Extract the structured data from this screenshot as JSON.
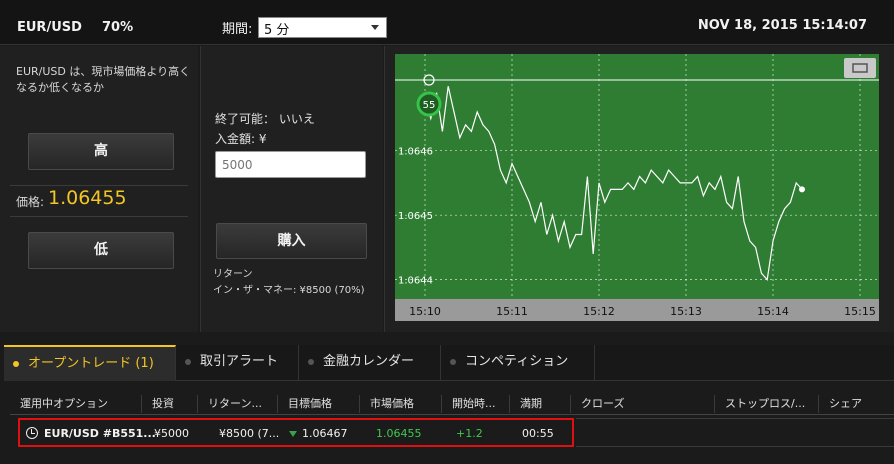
{
  "header": {
    "pair": "EUR/USD",
    "payout_pct": "70%",
    "period_label": "期間:",
    "period_value": "5 分",
    "datetime": "NOV 18, 2015 15:14:07"
  },
  "left": {
    "description": "EUR/USD は、現市場価格より高くなるか低くなるか",
    "high_label": "高",
    "price_label": "価格:",
    "price_value": "1.06455",
    "low_label": "低"
  },
  "mid": {
    "expiry_text": "終了可能： いいえ",
    "deposit_label": "入金額: ¥",
    "amount_placeholder": "5000",
    "buy_label": "購入",
    "return_label": "リターン",
    "in_the_money": "イン・ザ・マネー: ¥8500 (70%)"
  },
  "chart_data": {
    "type": "line",
    "x_ticks": [
      "15:10",
      "15:11",
      "15:12",
      "15:13",
      "15:14",
      "15:15"
    ],
    "y_ticks": [
      "1.0646",
      "1.0645",
      "1.0644"
    ],
    "ylim": [
      1.06437,
      1.06475
    ],
    "grid": true,
    "background": "#2e7d32",
    "line_color": "#ffffff",
    "marker_label": "55",
    "series": [
      {
        "points": [
          [
            "15:10:00",
            1.06468
          ],
          [
            "15:10:04",
            1.06465
          ],
          [
            "15:10:08",
            1.06469
          ],
          [
            "15:10:12",
            1.06463
          ],
          [
            "15:10:16",
            1.0647
          ],
          [
            "15:10:20",
            1.06466
          ],
          [
            "15:10:24",
            1.06462
          ],
          [
            "15:10:28",
            1.06464
          ],
          [
            "15:10:32",
            1.06463
          ],
          [
            "15:10:36",
            1.06466
          ],
          [
            "15:10:40",
            1.06464
          ],
          [
            "15:10:44",
            1.06463
          ],
          [
            "15:10:48",
            1.06461
          ],
          [
            "15:10:52",
            1.06457
          ],
          [
            "15:10:56",
            1.06455
          ],
          [
            "15:11:00",
            1.06458
          ],
          [
            "15:11:04",
            1.06456
          ],
          [
            "15:11:08",
            1.06454
          ],
          [
            "15:11:12",
            1.06452
          ],
          [
            "15:11:16",
            1.06449
          ],
          [
            "15:11:20",
            1.06452
          ],
          [
            "15:11:24",
            1.06447
          ],
          [
            "15:11:28",
            1.0645
          ],
          [
            "15:11:32",
            1.06446
          ],
          [
            "15:11:36",
            1.06449
          ],
          [
            "15:11:40",
            1.06445
          ],
          [
            "15:11:44",
            1.06447
          ],
          [
            "15:11:48",
            1.06447
          ],
          [
            "15:11:52",
            1.06456
          ],
          [
            "15:11:56",
            1.06444
          ],
          [
            "15:12:00",
            1.06455
          ],
          [
            "15:12:04",
            1.06452
          ],
          [
            "15:12:08",
            1.06454
          ],
          [
            "15:12:12",
            1.06454
          ],
          [
            "15:12:16",
            1.06454
          ],
          [
            "15:12:20",
            1.06455
          ],
          [
            "15:12:24",
            1.06454
          ],
          [
            "15:12:28",
            1.06456
          ],
          [
            "15:12:32",
            1.06455
          ],
          [
            "15:12:36",
            1.06457
          ],
          [
            "15:12:40",
            1.06456
          ],
          [
            "15:12:44",
            1.06455
          ],
          [
            "15:12:48",
            1.06457
          ],
          [
            "15:12:52",
            1.06456
          ],
          [
            "15:12:56",
            1.06455
          ],
          [
            "15:13:00",
            1.06455
          ],
          [
            "15:13:04",
            1.06455
          ],
          [
            "15:13:08",
            1.06456
          ],
          [
            "15:13:12",
            1.06453
          ],
          [
            "15:13:16",
            1.06455
          ],
          [
            "15:13:20",
            1.06454
          ],
          [
            "15:13:24",
            1.06456
          ],
          [
            "15:13:28",
            1.06452
          ],
          [
            "15:13:32",
            1.06451
          ],
          [
            "15:13:36",
            1.06456
          ],
          [
            "15:13:40",
            1.06449
          ],
          [
            "15:13:44",
            1.06446
          ],
          [
            "15:13:48",
            1.06445
          ],
          [
            "15:13:52",
            1.06441
          ],
          [
            "15:13:56",
            1.0644
          ],
          [
            "15:14:00",
            1.06446
          ],
          [
            "15:14:04",
            1.06449
          ],
          [
            "15:14:08",
            1.06451
          ],
          [
            "15:14:12",
            1.06452
          ],
          [
            "15:14:16",
            1.06455
          ],
          [
            "15:14:20",
            1.06454
          ]
        ]
      }
    ]
  },
  "tabs": [
    {
      "label": "オープントレード (1)"
    },
    {
      "label": "取引アラート"
    },
    {
      "label": "金融カレンダー"
    },
    {
      "label": "コンペティション"
    }
  ],
  "table": {
    "headers": [
      "運用中オプション",
      "投資",
      "リターン...",
      "目標価格",
      "市場価格",
      "開始時...",
      "満期",
      "クローズ",
      "ストップロス/...",
      "シェア"
    ],
    "row": {
      "option": "EUR/USD #B551...",
      "investment": "¥5000",
      "return": "¥8500 (7...",
      "target_price": "1.06467",
      "market_price": "1.06455",
      "start_diff": "+1.2",
      "expiry": "00:55"
    }
  },
  "colors": {
    "accent": "#f3c623",
    "chart_bg": "#2e7d32",
    "positive": "#3fc94f",
    "highlight_border": "#e01010"
  }
}
